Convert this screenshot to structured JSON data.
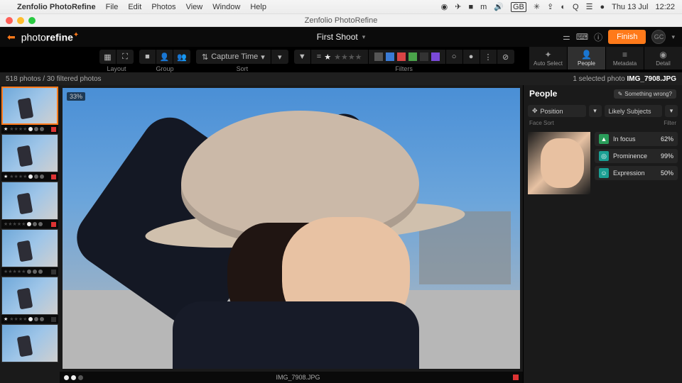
{
  "macos": {
    "app": "Zenfolio PhotoRefine",
    "menus": [
      "File",
      "Edit",
      "Photos",
      "View",
      "Window",
      "Help"
    ],
    "status_icons": [
      "◉",
      "✈",
      "■",
      "m",
      "🔊",
      "GB",
      "✳",
      "⇪",
      "◐",
      "Q",
      "☰",
      "●"
    ],
    "date": "Thu 13 Jul",
    "time": "12:22",
    "window_title": "Zenfolio PhotoRefine"
  },
  "header": {
    "logo_light": "photo",
    "logo_bold": "refine",
    "project": "First Shoot",
    "finish": "Finish",
    "avatar": "GC"
  },
  "toolbar": {
    "layout": {
      "label": "Layout"
    },
    "group": {
      "label": "Group"
    },
    "sort": {
      "label": "Sort",
      "value": "Capture Time"
    },
    "filters": {
      "label": "Filters",
      "stars": "★★★★★",
      "colors": [
        "#555",
        "#3a7bd5",
        "#d94545",
        "#4aa34a",
        "#333",
        "#7a4ad9"
      ]
    },
    "righttabs": [
      {
        "icon": "✦",
        "label": "Auto Select"
      },
      {
        "icon": "👤",
        "label": "People"
      },
      {
        "icon": "≡",
        "label": "Metadata"
      },
      {
        "icon": "◉",
        "label": "Detail"
      }
    ]
  },
  "status": {
    "left": "518 photos / 30 filtered photos",
    "right_label": "1 selected photo",
    "filename": "IMG_7908.JPG"
  },
  "viewer": {
    "zoom": "33%",
    "filename": "IMG_7908.JPG"
  },
  "thumbs": [
    {
      "stars": 1,
      "red": true,
      "sel": true
    },
    {
      "stars": 1,
      "red": true
    },
    {
      "stars": 0,
      "red": true
    },
    {
      "stars": 0,
      "red": false
    },
    {
      "stars": 1,
      "red": false
    }
  ],
  "people": {
    "title": "People",
    "wrong": "Something wrong?",
    "position_label": "Position",
    "likely_label": "Likely Subjects",
    "facesort": "Face Sort",
    "filter": "Filter",
    "metrics": [
      {
        "icon": "▲",
        "cls": "green",
        "label": "In focus",
        "val": "62%"
      },
      {
        "icon": "◎",
        "cls": "teal",
        "label": "Prominence",
        "val": "99%"
      },
      {
        "icon": "☺",
        "cls": "cyan",
        "label": "Expression",
        "val": "50%"
      }
    ]
  }
}
